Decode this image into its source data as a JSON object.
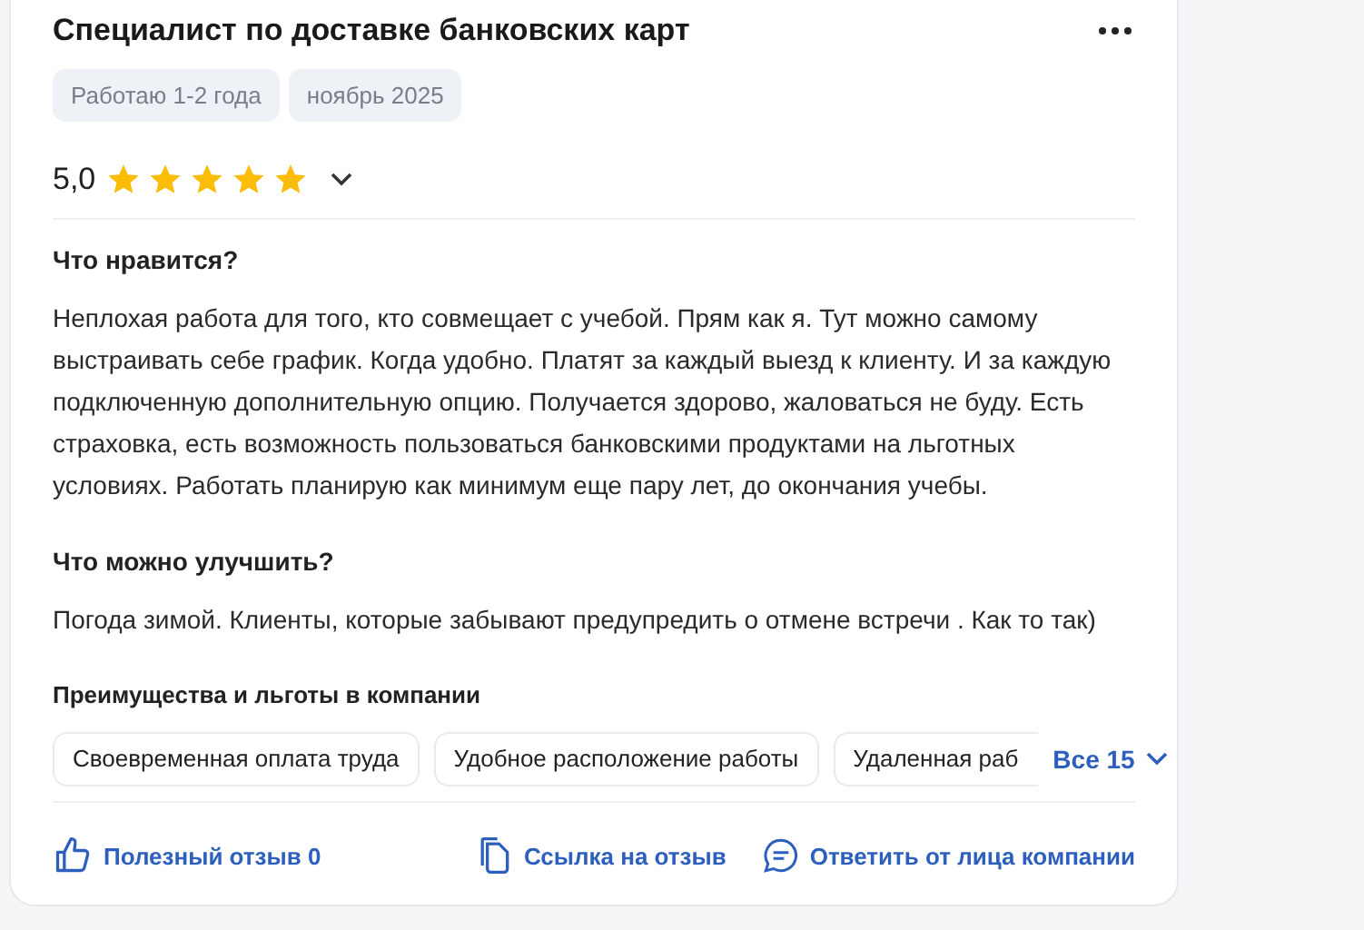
{
  "title": "Специалист по доставке банковских карт",
  "tags": [
    "Работаю 1-2 года",
    "ноябрь 2025"
  ],
  "rating": {
    "value": "5,0",
    "stars": 5
  },
  "sections": [
    {
      "heading": "Что нравится?",
      "text": "Неплохая работа для того, кто совмещает с учебой. Прям как я. Тут можно самому выстраивать себе график. Когда удобно. Платят за каждый выезд к клиенту. И за каждую подключенную дополнительную опцию. Получается здорово, жаловаться не буду. Есть страховка, есть возможность пользоваться банковскими продуктами на льготных условиях. Работать планирую как минимум еще пару лет, до окончания учебы."
    },
    {
      "heading": "Что можно улучшить?",
      "text": "Погода зимой. Клиенты, которые забывают предупредить о отмене встречи . Как то так)"
    }
  ],
  "benefits": {
    "heading": "Преимущества и льготы в компании",
    "items": [
      "Своевременная оплата труда",
      "Удобное расположение работы",
      "Удаленная раб"
    ],
    "more": "Все 15"
  },
  "footer": {
    "helpful": "Полезный отзыв 0",
    "link": "Ссылка на отзыв",
    "reply": "Ответить от лица компании"
  }
}
